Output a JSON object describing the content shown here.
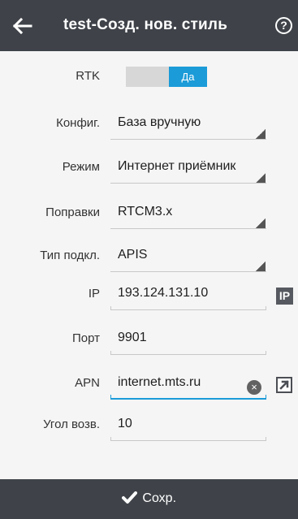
{
  "appbar": {
    "title": "test-Созд. нов. стиль",
    "back_icon": "arrow-left-icon",
    "help_icon": "question-circle-icon",
    "help_glyph": "?"
  },
  "form": {
    "rtk": {
      "label": "RTK",
      "toggle_on": "Да"
    },
    "config": {
      "label": "Конфиг.",
      "value": "База вручную"
    },
    "mode": {
      "label": "Режим",
      "value": "Интернет приёмник"
    },
    "corrections": {
      "label": "Поправки",
      "value": "RTCM3.x"
    },
    "conn_type": {
      "label": "Тип подкл.",
      "value": "APIS"
    },
    "ip": {
      "label": "IP",
      "value": "193.124.131.10",
      "button_text": "IP"
    },
    "port": {
      "label": "Порт",
      "value": "9901"
    },
    "apn": {
      "label": "APN",
      "value": "internet.mts.ru",
      "clear_glyph": "×"
    },
    "elevation": {
      "label": "Угол возв.",
      "value": "10"
    }
  },
  "footer": {
    "save_label": "Сохр.",
    "save_icon": "checkmark-icon"
  },
  "colors": {
    "appbar": "#3f4349",
    "accent": "#1b9bd8",
    "background": "#f5f5f5"
  }
}
